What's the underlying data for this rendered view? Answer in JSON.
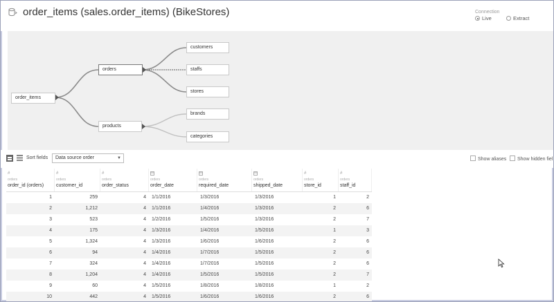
{
  "header": {
    "title": "order_items (sales.order_items) (BikeStores)",
    "connection": {
      "label": "Connection",
      "options": [
        "Live",
        "Extract"
      ],
      "selected": "Live"
    }
  },
  "canvas": {
    "nodes": {
      "order_items": "order_items",
      "orders": "orders",
      "products": "products",
      "customers": "customers",
      "staffs": "staffs",
      "stores": "stores",
      "brands": "brands",
      "categories": "categories"
    }
  },
  "toolbar": {
    "sort_label": "Sort fields",
    "sort_value": "Data source order",
    "show_aliases": "Show aliases",
    "show_hidden": "Show hidden fiel"
  },
  "table": {
    "columns": [
      {
        "type_icon": "#",
        "source": "orders",
        "name": "order_id (orders)",
        "align": "right"
      },
      {
        "type_icon": "#",
        "source": "orders",
        "name": "customer_id",
        "align": "right"
      },
      {
        "type_icon": "#",
        "source": "orders",
        "name": "order_status",
        "align": "right"
      },
      {
        "type_icon": "date-icon",
        "source": "orders",
        "name": "order_date",
        "align": "left"
      },
      {
        "type_icon": "date-icon",
        "source": "orders",
        "name": "required_date",
        "align": "left"
      },
      {
        "type_icon": "date-icon",
        "source": "orders",
        "name": "shipped_date",
        "align": "left"
      },
      {
        "type_icon": "#",
        "source": "orders",
        "name": "store_id",
        "align": "right"
      },
      {
        "type_icon": "#",
        "source": "orders",
        "name": "staff_id",
        "align": "right"
      }
    ],
    "rows": [
      [
        "1",
        "259",
        "4",
        "1/1/2016",
        "1/3/2016",
        "1/3/2016",
        "1",
        "2"
      ],
      [
        "2",
        "1,212",
        "4",
        "1/1/2016",
        "1/4/2016",
        "1/3/2016",
        "2",
        "6"
      ],
      [
        "3",
        "523",
        "4",
        "1/2/2016",
        "1/5/2016",
        "1/3/2016",
        "2",
        "7"
      ],
      [
        "4",
        "175",
        "4",
        "1/3/2016",
        "1/4/2016",
        "1/5/2016",
        "1",
        "3"
      ],
      [
        "5",
        "1,324",
        "4",
        "1/3/2016",
        "1/6/2016",
        "1/6/2016",
        "2",
        "6"
      ],
      [
        "6",
        "94",
        "4",
        "1/4/2016",
        "1/7/2016",
        "1/5/2016",
        "2",
        "6"
      ],
      [
        "7",
        "324",
        "4",
        "1/4/2016",
        "1/7/2016",
        "1/5/2016",
        "2",
        "6"
      ],
      [
        "8",
        "1,204",
        "4",
        "1/4/2016",
        "1/5/2016",
        "1/5/2016",
        "2",
        "7"
      ],
      [
        "9",
        "60",
        "4",
        "1/5/2016",
        "1/8/2016",
        "1/8/2016",
        "1",
        "2"
      ],
      [
        "10",
        "442",
        "4",
        "1/5/2016",
        "1/6/2016",
        "1/6/2016",
        "2",
        "6"
      ]
    ]
  }
}
